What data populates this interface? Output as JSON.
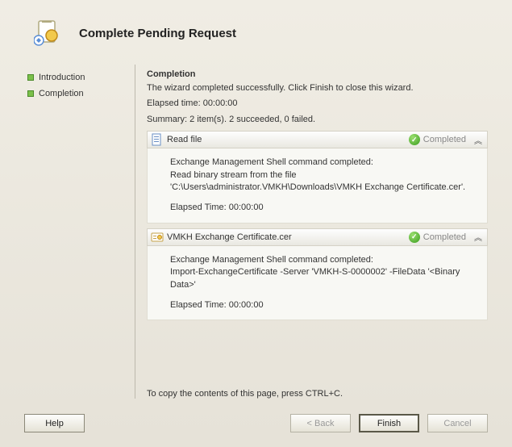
{
  "header": {
    "title": "Complete Pending Request"
  },
  "sidebar": {
    "items": [
      {
        "label": "Introduction"
      },
      {
        "label": "Completion"
      }
    ]
  },
  "content": {
    "heading": "Completion",
    "wizard_text": "The wizard completed successfully. Click Finish to close this wizard.",
    "elapsed_label": "Elapsed time: 00:00:00",
    "summary": "Summary: 2 item(s). 2 succeeded, 0 failed."
  },
  "tasks": [
    {
      "title": "Read file",
      "status": "Completed",
      "line1": "Exchange Management Shell command completed:",
      "line2": "Read binary stream from the file 'C:\\Users\\administrator.VMKH\\Downloads\\VMKH Exchange Certificate.cer'.",
      "elapsed": "Elapsed Time: 00:00:00"
    },
    {
      "title": "VMKH Exchange Certificate.cer",
      "status": "Completed",
      "line1": "Exchange Management Shell command completed:",
      "line2": "Import-ExchangeCertificate -Server 'VMKH-S-0000002' -FileData '<Binary Data>'",
      "elapsed": "Elapsed Time: 00:00:00"
    }
  ],
  "footer": {
    "copy_hint": "To copy the contents of this page, press CTRL+C.",
    "help": "Help",
    "back": "< Back",
    "finish": "Finish",
    "cancel": "Cancel"
  }
}
